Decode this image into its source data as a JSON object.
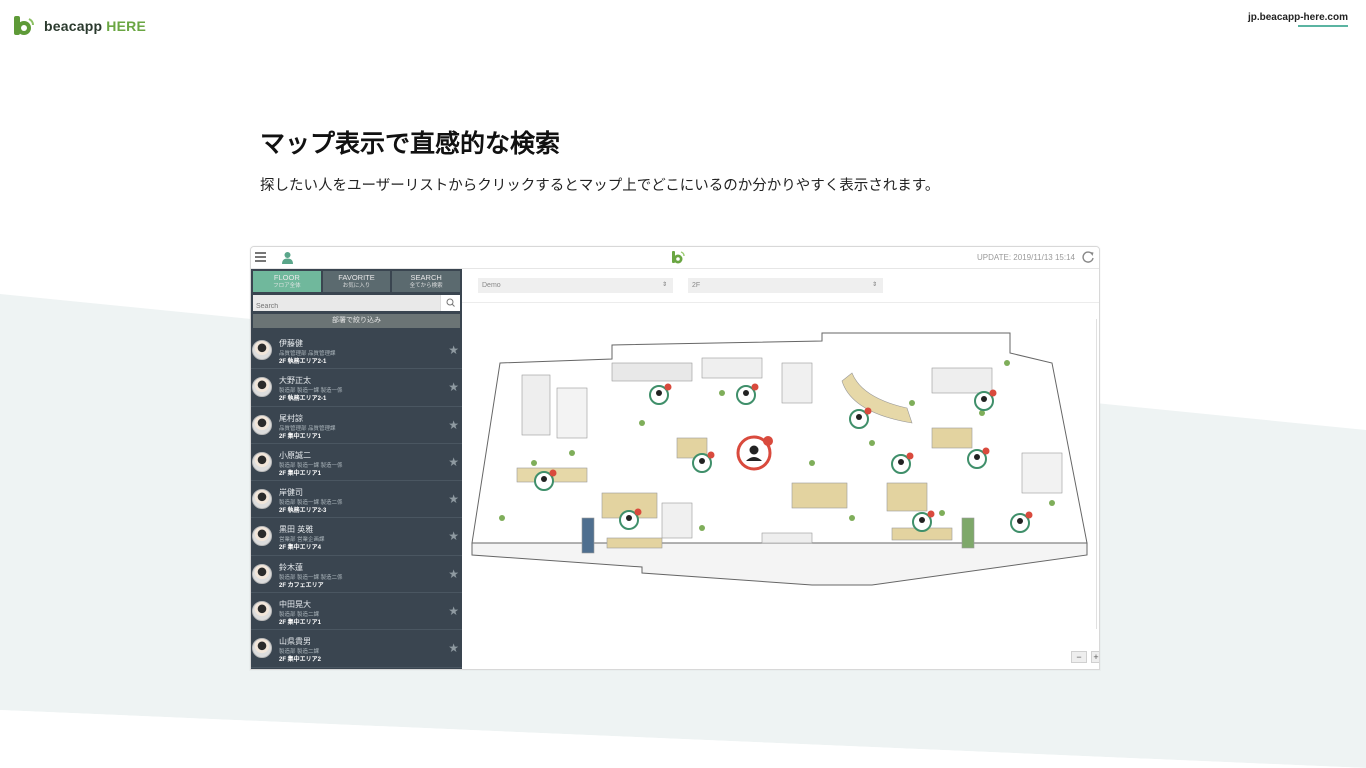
{
  "header": {
    "brand_word": "beacapp",
    "brand_here": "HERE",
    "site_url": "jp.beacapp-here.com"
  },
  "hero": {
    "title": "マップ表示で直感的な検索",
    "subtitle": "探したい人をユーザーリストからクリックするとマップ上でどこにいるのか分かりやすく表示されます。"
  },
  "app": {
    "update_text": "UPDATE: 2019/11/13 15:14",
    "tabs": [
      {
        "label": "FLOOR",
        "sub": "フロア全体",
        "active": true
      },
      {
        "label": "FAVORITE",
        "sub": "お気に入り",
        "active": false
      },
      {
        "label": "SEARCH",
        "sub": "全てから検索",
        "active": false
      }
    ],
    "search_placeholder": "Search",
    "filter_label": "部署で絞り込み",
    "users": [
      {
        "name": "伊藤健",
        "dept": "品質管理部 品質管理課",
        "location": "2F 執務エリア2-1"
      },
      {
        "name": "大野正太",
        "dept": "製造部 製造一課 製造一係",
        "location": "2F 執務エリア2-1"
      },
      {
        "name": "尾村諒",
        "dept": "品質管理部 品質管理課",
        "location": "2F 集中エリア1"
      },
      {
        "name": "小原誠二",
        "dept": "製造部 製造一課 製造一係",
        "location": "2F 集中エリア1"
      },
      {
        "name": "岸健司",
        "dept": "製造部 製造一課 製造二係",
        "location": "2F 執務エリア2-3"
      },
      {
        "name": "黒田 英雅",
        "dept": "営業部 営業企画課",
        "location": "2F 集中エリア4"
      },
      {
        "name": "鈴木蓮",
        "dept": "製造部 製造一課 製造二係",
        "location": "2F カフェエリア"
      },
      {
        "name": "中田晃大",
        "dept": "製造部 製造二課",
        "location": "2F 集中エリア1"
      },
      {
        "name": "山県貴男",
        "dept": "製造部 製造二課",
        "location": "2F 集中エリア2"
      }
    ],
    "building_select": "Demo",
    "floor_select": "2F",
    "zoom_out_label": "−",
    "zoom_in_label": "+"
  },
  "colors": {
    "brand_green": "#6aa642",
    "tab_active": "#70b89c",
    "sidebar_bg": "#3a4550",
    "marker_highlight": "#d94a3d",
    "marker_normal": "#3f8f6a"
  }
}
